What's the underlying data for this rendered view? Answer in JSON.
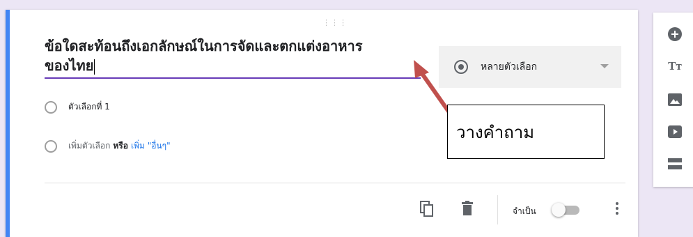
{
  "question": {
    "title_line1": "ข้อใดสะท้อนถึงเอกลักษณ์ในการจัดและตกแต่งอาหาร",
    "title_line2": "ของไทย"
  },
  "question_type": {
    "selected_label": "หลายตัวเลือก",
    "icon": "radio-checked-icon"
  },
  "options": {
    "option1_label": "ตัวเลือกที่ 1",
    "add_option_label": "เพิ่มตัวเลือก",
    "or_label": "หรือ",
    "add_other_label": "เพิ่ม \"อื่นๆ\""
  },
  "footer": {
    "required_label": "จำเป็น",
    "required_enabled": false,
    "icons": [
      "duplicate-icon",
      "delete-icon",
      "more-vert-icon"
    ]
  },
  "annotation": {
    "callout_text": "วางคำถาม",
    "arrow_color": "#c0504d"
  },
  "side_toolbar": {
    "icons": [
      "add-question-icon",
      "add-title-icon",
      "add-image-icon",
      "add-video-icon",
      "add-section-icon"
    ]
  },
  "colors": {
    "accent": "#4285f4",
    "underline": "#673ab7",
    "link": "#1a73e8",
    "background": "#ece6f5"
  }
}
